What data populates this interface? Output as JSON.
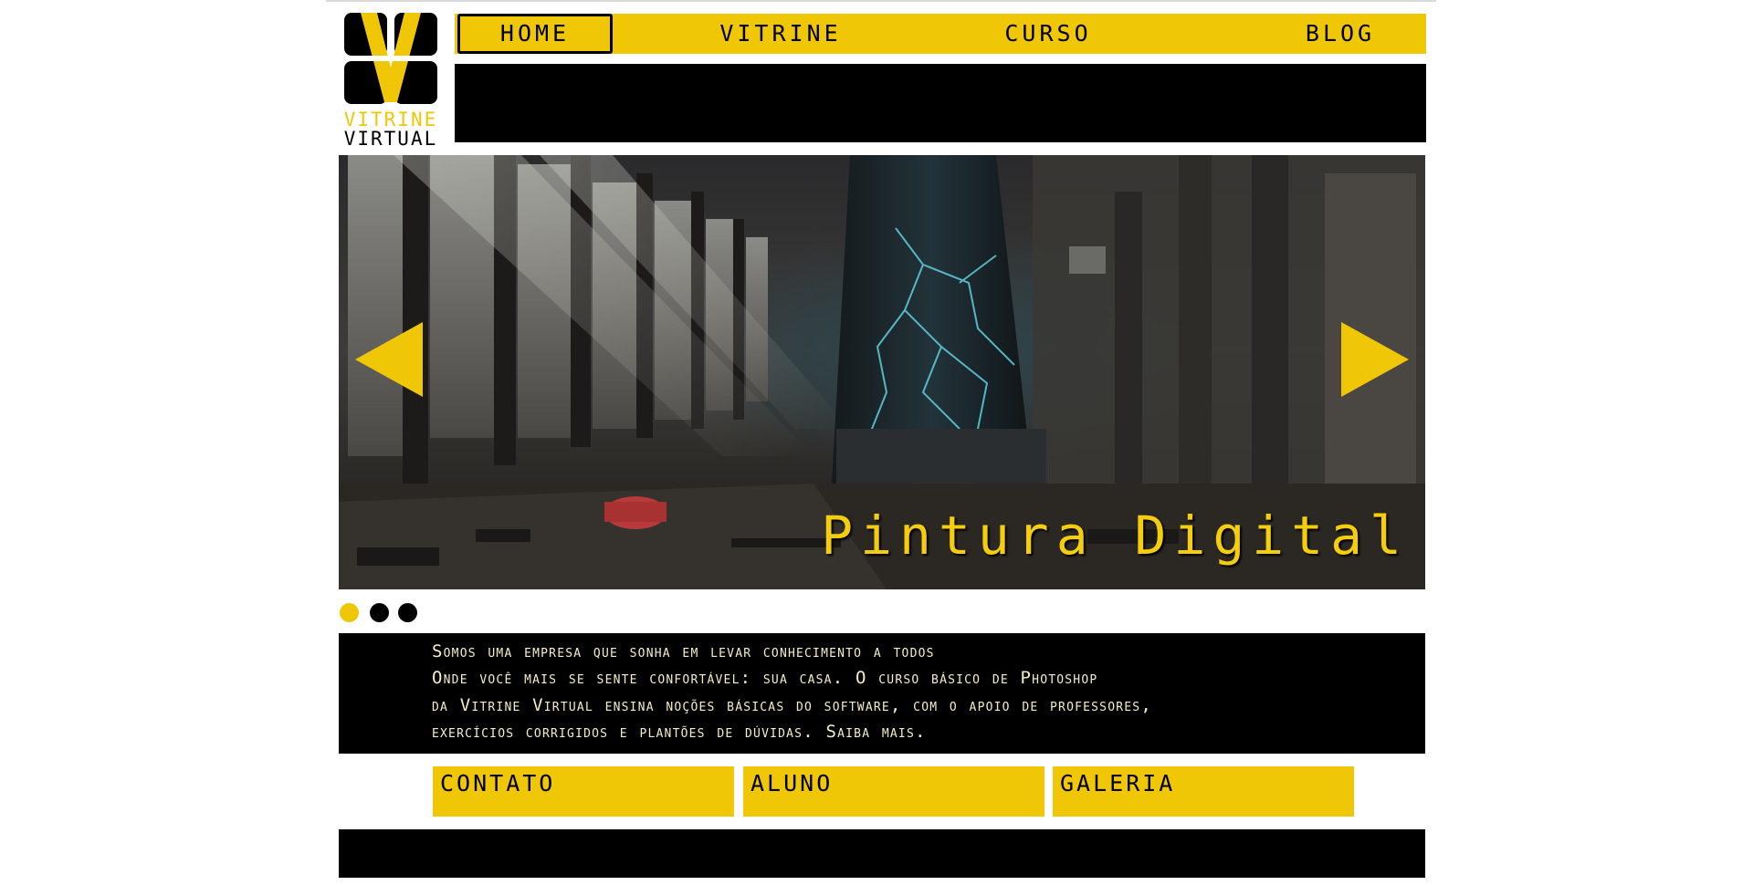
{
  "logo": {
    "line1": "VITRINE",
    "line2": "VIRTUAL",
    "accent_color": "#f0c707"
  },
  "nav": {
    "items": [
      {
        "label": "HOME",
        "active": true
      },
      {
        "label": "VITRINE",
        "active": false
      },
      {
        "label": "CURSO",
        "active": false
      },
      {
        "label": "BLOG",
        "active": false
      }
    ]
  },
  "hero": {
    "title": "Pintura Digital",
    "prev_icon": "triangle-left",
    "next_icon": "triangle-right",
    "slides": [
      {
        "active": true
      },
      {
        "active": false
      },
      {
        "active": false
      }
    ]
  },
  "description": {
    "lines": [
      "Somos uma empresa que sonha em levar conhecimento a todos",
      "Onde você mais se sente confortável: sua casa. O curso básico de Photoshop",
      "da Vitrine Virtual ensina noções básicas do software, com o apoio de professores,",
      "exercícios corrigidos e plantões de dúvidas. Saiba mais."
    ]
  },
  "buttons": {
    "contato": "CONTATO",
    "aluno": "ALUNO",
    "galeria": "GALERIA"
  },
  "colors": {
    "brand_yellow": "#f0c707",
    "black": "#000000",
    "dot_active": "#f0c707",
    "dot_inactive": "#000000"
  }
}
